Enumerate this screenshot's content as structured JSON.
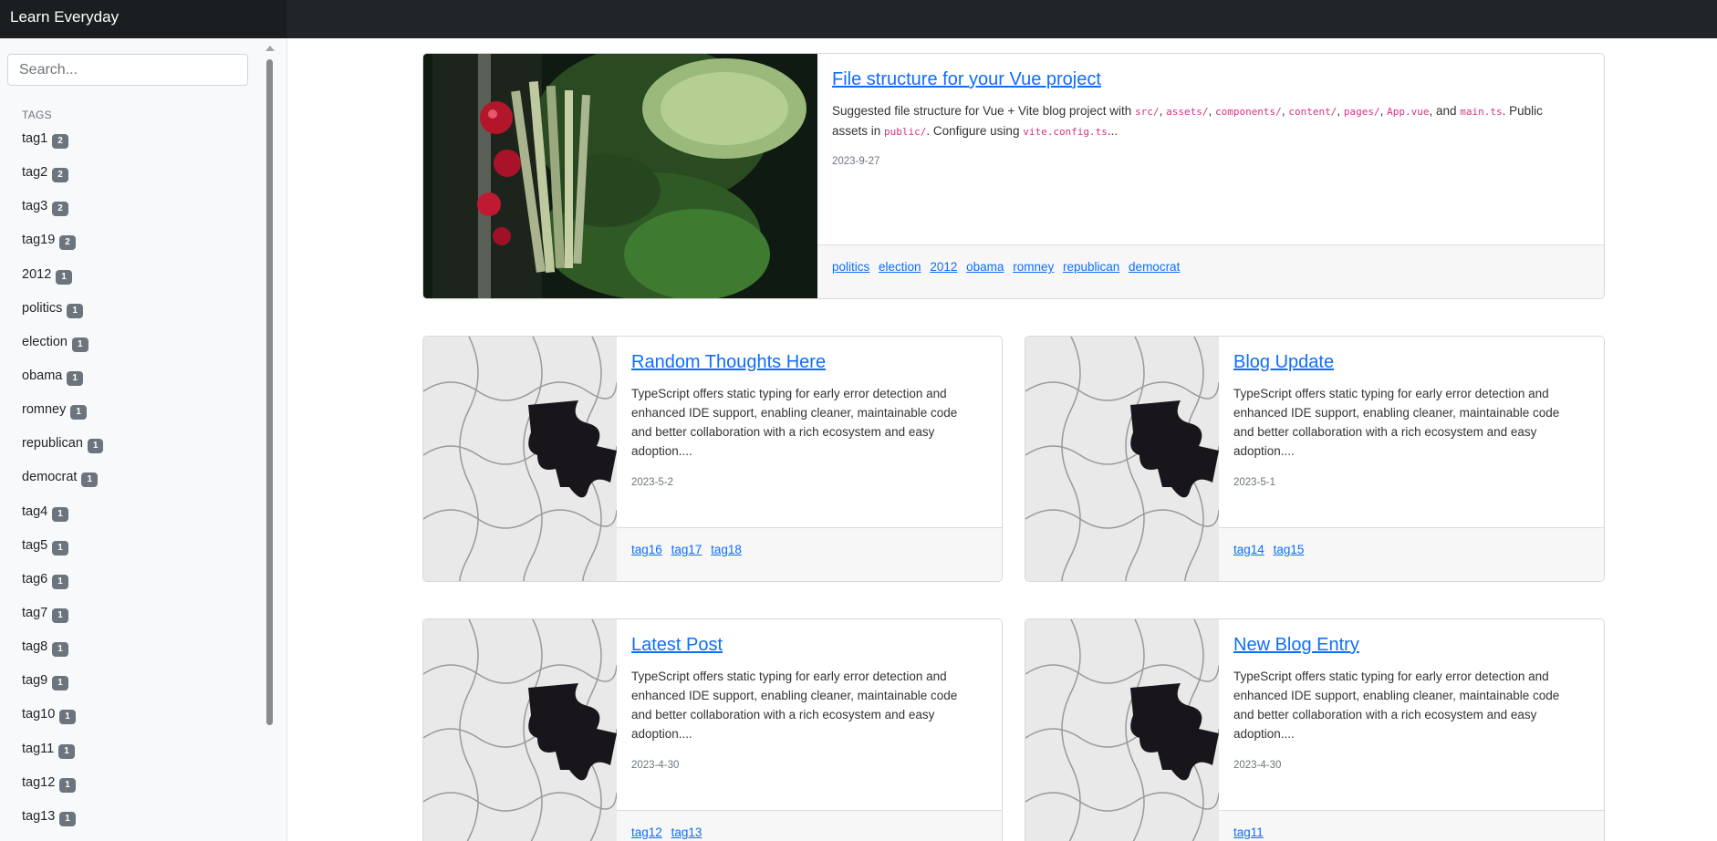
{
  "app": {
    "brand": "Learn Everyday"
  },
  "search": {
    "placeholder": "Search..."
  },
  "sidebar": {
    "tags_heading": "TAGS",
    "tags": [
      {
        "name": "tag1",
        "count": "2"
      },
      {
        "name": "tag2",
        "count": "2"
      },
      {
        "name": "tag3",
        "count": "2"
      },
      {
        "name": "tag19",
        "count": "2"
      },
      {
        "name": "2012",
        "count": "1"
      },
      {
        "name": "politics",
        "count": "1"
      },
      {
        "name": "election",
        "count": "1"
      },
      {
        "name": "obama",
        "count": "1"
      },
      {
        "name": "romney",
        "count": "1"
      },
      {
        "name": "republican",
        "count": "1"
      },
      {
        "name": "democrat",
        "count": "1"
      },
      {
        "name": "tag4",
        "count": "1"
      },
      {
        "name": "tag5",
        "count": "1"
      },
      {
        "name": "tag6",
        "count": "1"
      },
      {
        "name": "tag7",
        "count": "1"
      },
      {
        "name": "tag8",
        "count": "1"
      },
      {
        "name": "tag9",
        "count": "1"
      },
      {
        "name": "tag10",
        "count": "1"
      },
      {
        "name": "tag11",
        "count": "1"
      },
      {
        "name": "tag12",
        "count": "1"
      },
      {
        "name": "tag13",
        "count": "1"
      }
    ]
  },
  "posts": {
    "featured": {
      "title": "File structure for your Vue project",
      "desc_1": "Suggested file structure for Vue + Vite blog project with ",
      "code_src": "src/",
      "sep": ", ",
      "code_assets": "assets/",
      "code_components": "components/",
      "code_content": "content/",
      "code_pages": "pages/",
      "code_app": "App.vue",
      "and": ", and ",
      "code_main": "main.ts",
      "desc_2": ". Public assets in ",
      "code_public": "public/",
      "desc_3": ". Configure using ",
      "code_vite": "vite.config.ts",
      "desc_end": "...",
      "date": "2023-9-27",
      "tags": [
        "politics",
        "election",
        "2012",
        "obama",
        "romney",
        "republican",
        "democrat"
      ]
    },
    "grid": [
      {
        "title": "Random Thoughts Here",
        "description": "TypeScript offers static typing for early error detection and enhanced IDE support, enabling cleaner, maintainable code and better collaboration with a rich ecosystem and easy adoption....",
        "date": "2023-5-2",
        "tags": [
          "tag16",
          "tag17",
          "tag18"
        ]
      },
      {
        "title": "Blog Update",
        "description": "TypeScript offers static typing for early error detection and enhanced IDE support, enabling cleaner, maintainable code and better collaboration with a rich ecosystem and easy adoption....",
        "date": "2023-5-1",
        "tags": [
          "tag14",
          "tag15"
        ]
      },
      {
        "title": "Latest Post",
        "description": "TypeScript offers static typing for early error detection and enhanced IDE support, enabling cleaner, maintainable code and better collaboration with a rich ecosystem and easy adoption....",
        "date": "2023-4-30",
        "tags": [
          "tag12",
          "tag13"
        ]
      },
      {
        "title": "New Blog Entry",
        "description": "TypeScript offers static typing for early error detection and enhanced IDE support, enabling cleaner, maintainable code and better collaboration with a rich ecosystem and easy adoption....",
        "date": "2023-4-30",
        "tags": [
          "tag11"
        ]
      }
    ]
  }
}
